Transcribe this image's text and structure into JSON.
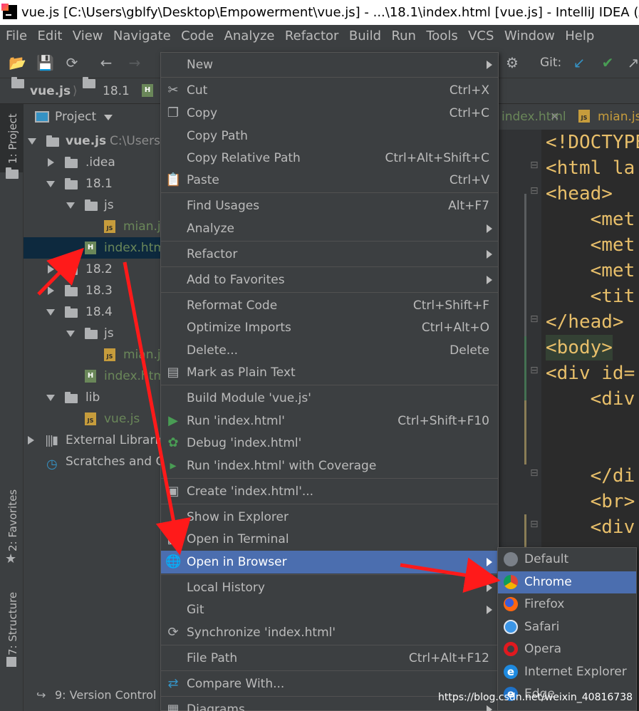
{
  "window": {
    "title": "vue.js [C:\\Users\\gblfy\\Desktop\\Empowerment\\vue.js] - ...\\18.1\\index.html [vue.js] - IntelliJ IDEA (Admi"
  },
  "menubar": [
    "File",
    "Edit",
    "View",
    "Navigate",
    "Code",
    "Analyze",
    "Refactor",
    "Build",
    "Run",
    "Tools",
    "VCS",
    "Window",
    "Help"
  ],
  "toolbar": {
    "git_label": "Git:"
  },
  "breadcrumb": {
    "project": "vue.js",
    "folder": "18.1"
  },
  "left_strip": {
    "project_tab": "1: Project",
    "favorites_tab": "2: Favorites",
    "structure_tab": "7: Structure"
  },
  "project_panel": {
    "title": "Project",
    "tree": [
      {
        "label": "vue.js",
        "extra": "C:\\Users",
        "kind": "folder",
        "expanded": true
      },
      {
        "label": ".idea",
        "kind": "folder",
        "expanded": false
      },
      {
        "label": "18.1",
        "kind": "folder",
        "expanded": true
      },
      {
        "label": "js",
        "kind": "folder",
        "expanded": true
      },
      {
        "label": "mian.js",
        "kind": "js"
      },
      {
        "label": "index.html",
        "kind": "html",
        "selected": true
      },
      {
        "label": "18.2",
        "kind": "folder",
        "expanded": false
      },
      {
        "label": "18.3",
        "kind": "folder",
        "expanded": false
      },
      {
        "label": "18.4",
        "kind": "folder",
        "expanded": true
      },
      {
        "label": "js",
        "kind": "folder",
        "expanded": true
      },
      {
        "label": "mian.js",
        "kind": "js"
      },
      {
        "label": "index.html",
        "kind": "html"
      },
      {
        "label": "lib",
        "kind": "folder",
        "expanded": true
      },
      {
        "label": "vue.js",
        "kind": "js"
      },
      {
        "label": "External Libraries",
        "kind": "libs"
      },
      {
        "label": "Scratches and Consoles",
        "kind": "scratch"
      }
    ]
  },
  "bottom": {
    "version_control": "9: Version Control"
  },
  "editor": {
    "tabs": [
      {
        "label": "index.html"
      },
      {
        "label": "mian.js"
      }
    ],
    "lines": [
      "<!DOCTYPE",
      "<html la",
      "<head>",
      "    <met",
      "    <met",
      "    <met",
      "    <tit",
      "</head>",
      "<body>",
      "<div id=",
      "    <div",
      "",
      "",
      "    </di",
      "    <br>",
      "    <div"
    ]
  },
  "context_menu": {
    "items": [
      {
        "label": "New",
        "submenu": true
      },
      {
        "label": "Cut",
        "shortcut": "Ctrl+X",
        "icon": "scissors-icon"
      },
      {
        "label": "Copy",
        "shortcut": "Ctrl+C",
        "icon": "copy-icon"
      },
      {
        "label": "Copy Path"
      },
      {
        "label": "Copy Relative Path",
        "shortcut": "Ctrl+Alt+Shift+C"
      },
      {
        "label": "Paste",
        "shortcut": "Ctrl+V",
        "icon": "paste-icon"
      },
      {
        "label": "Find Usages",
        "shortcut": "Alt+F7"
      },
      {
        "label": "Analyze",
        "submenu": true
      },
      {
        "label": "Refactor",
        "submenu": true
      },
      {
        "label": "Add to Favorites",
        "submenu": true
      },
      {
        "label": "Reformat Code",
        "shortcut": "Ctrl+Shift+F"
      },
      {
        "label": "Optimize Imports",
        "shortcut": "Ctrl+Alt+O"
      },
      {
        "label": "Delete...",
        "shortcut": "Delete"
      },
      {
        "label": "Mark as Plain Text",
        "icon": "plain-text-icon"
      },
      {
        "label": "Build Module 'vue.js'"
      },
      {
        "label": "Run 'index.html'",
        "shortcut": "Ctrl+Shift+F10",
        "icon": "run-icon"
      },
      {
        "label": "Debug 'index.html'",
        "icon": "debug-icon"
      },
      {
        "label": "Run 'index.html' with Coverage",
        "icon": "coverage-icon"
      },
      {
        "label": "Create 'index.html'...",
        "icon": "create-config-icon"
      },
      {
        "label": "Show in Explorer"
      },
      {
        "label": "Open in Terminal",
        "icon": "terminal-icon"
      },
      {
        "label": "Open in Browser",
        "submenu": true,
        "icon": "globe-icon",
        "highlighted": true
      },
      {
        "label": "Local History",
        "submenu": true
      },
      {
        "label": "Git",
        "submenu": true
      },
      {
        "label": "Synchronize 'index.html'",
        "icon": "sync-icon"
      },
      {
        "label": "File Path",
        "shortcut": "Ctrl+Alt+F12"
      },
      {
        "label": "Compare With...",
        "icon": "compare-icon"
      },
      {
        "label": "Diagrams",
        "submenu": true,
        "icon": "diagram-icon"
      }
    ]
  },
  "browser_submenu": {
    "items": [
      {
        "label": "Default",
        "icon": "globe-icon"
      },
      {
        "label": "Chrome",
        "icon": "chrome-icon",
        "highlighted": true
      },
      {
        "label": "Firefox",
        "icon": "firefox-icon"
      },
      {
        "label": "Safari",
        "icon": "safari-icon"
      },
      {
        "label": "Opera",
        "icon": "opera-icon"
      },
      {
        "label": "Internet Explorer",
        "icon": "ie-icon"
      },
      {
        "label": "Edge",
        "icon": "edge-icon"
      }
    ]
  },
  "watermark": "https://blog.csdn.net/weixin_40816738",
  "colors": {
    "highlight": "#4b6eaf",
    "panel": "#3c3f41",
    "editor_bg": "#2b2b2b",
    "annotation_arrow": "#ff1a1a"
  }
}
